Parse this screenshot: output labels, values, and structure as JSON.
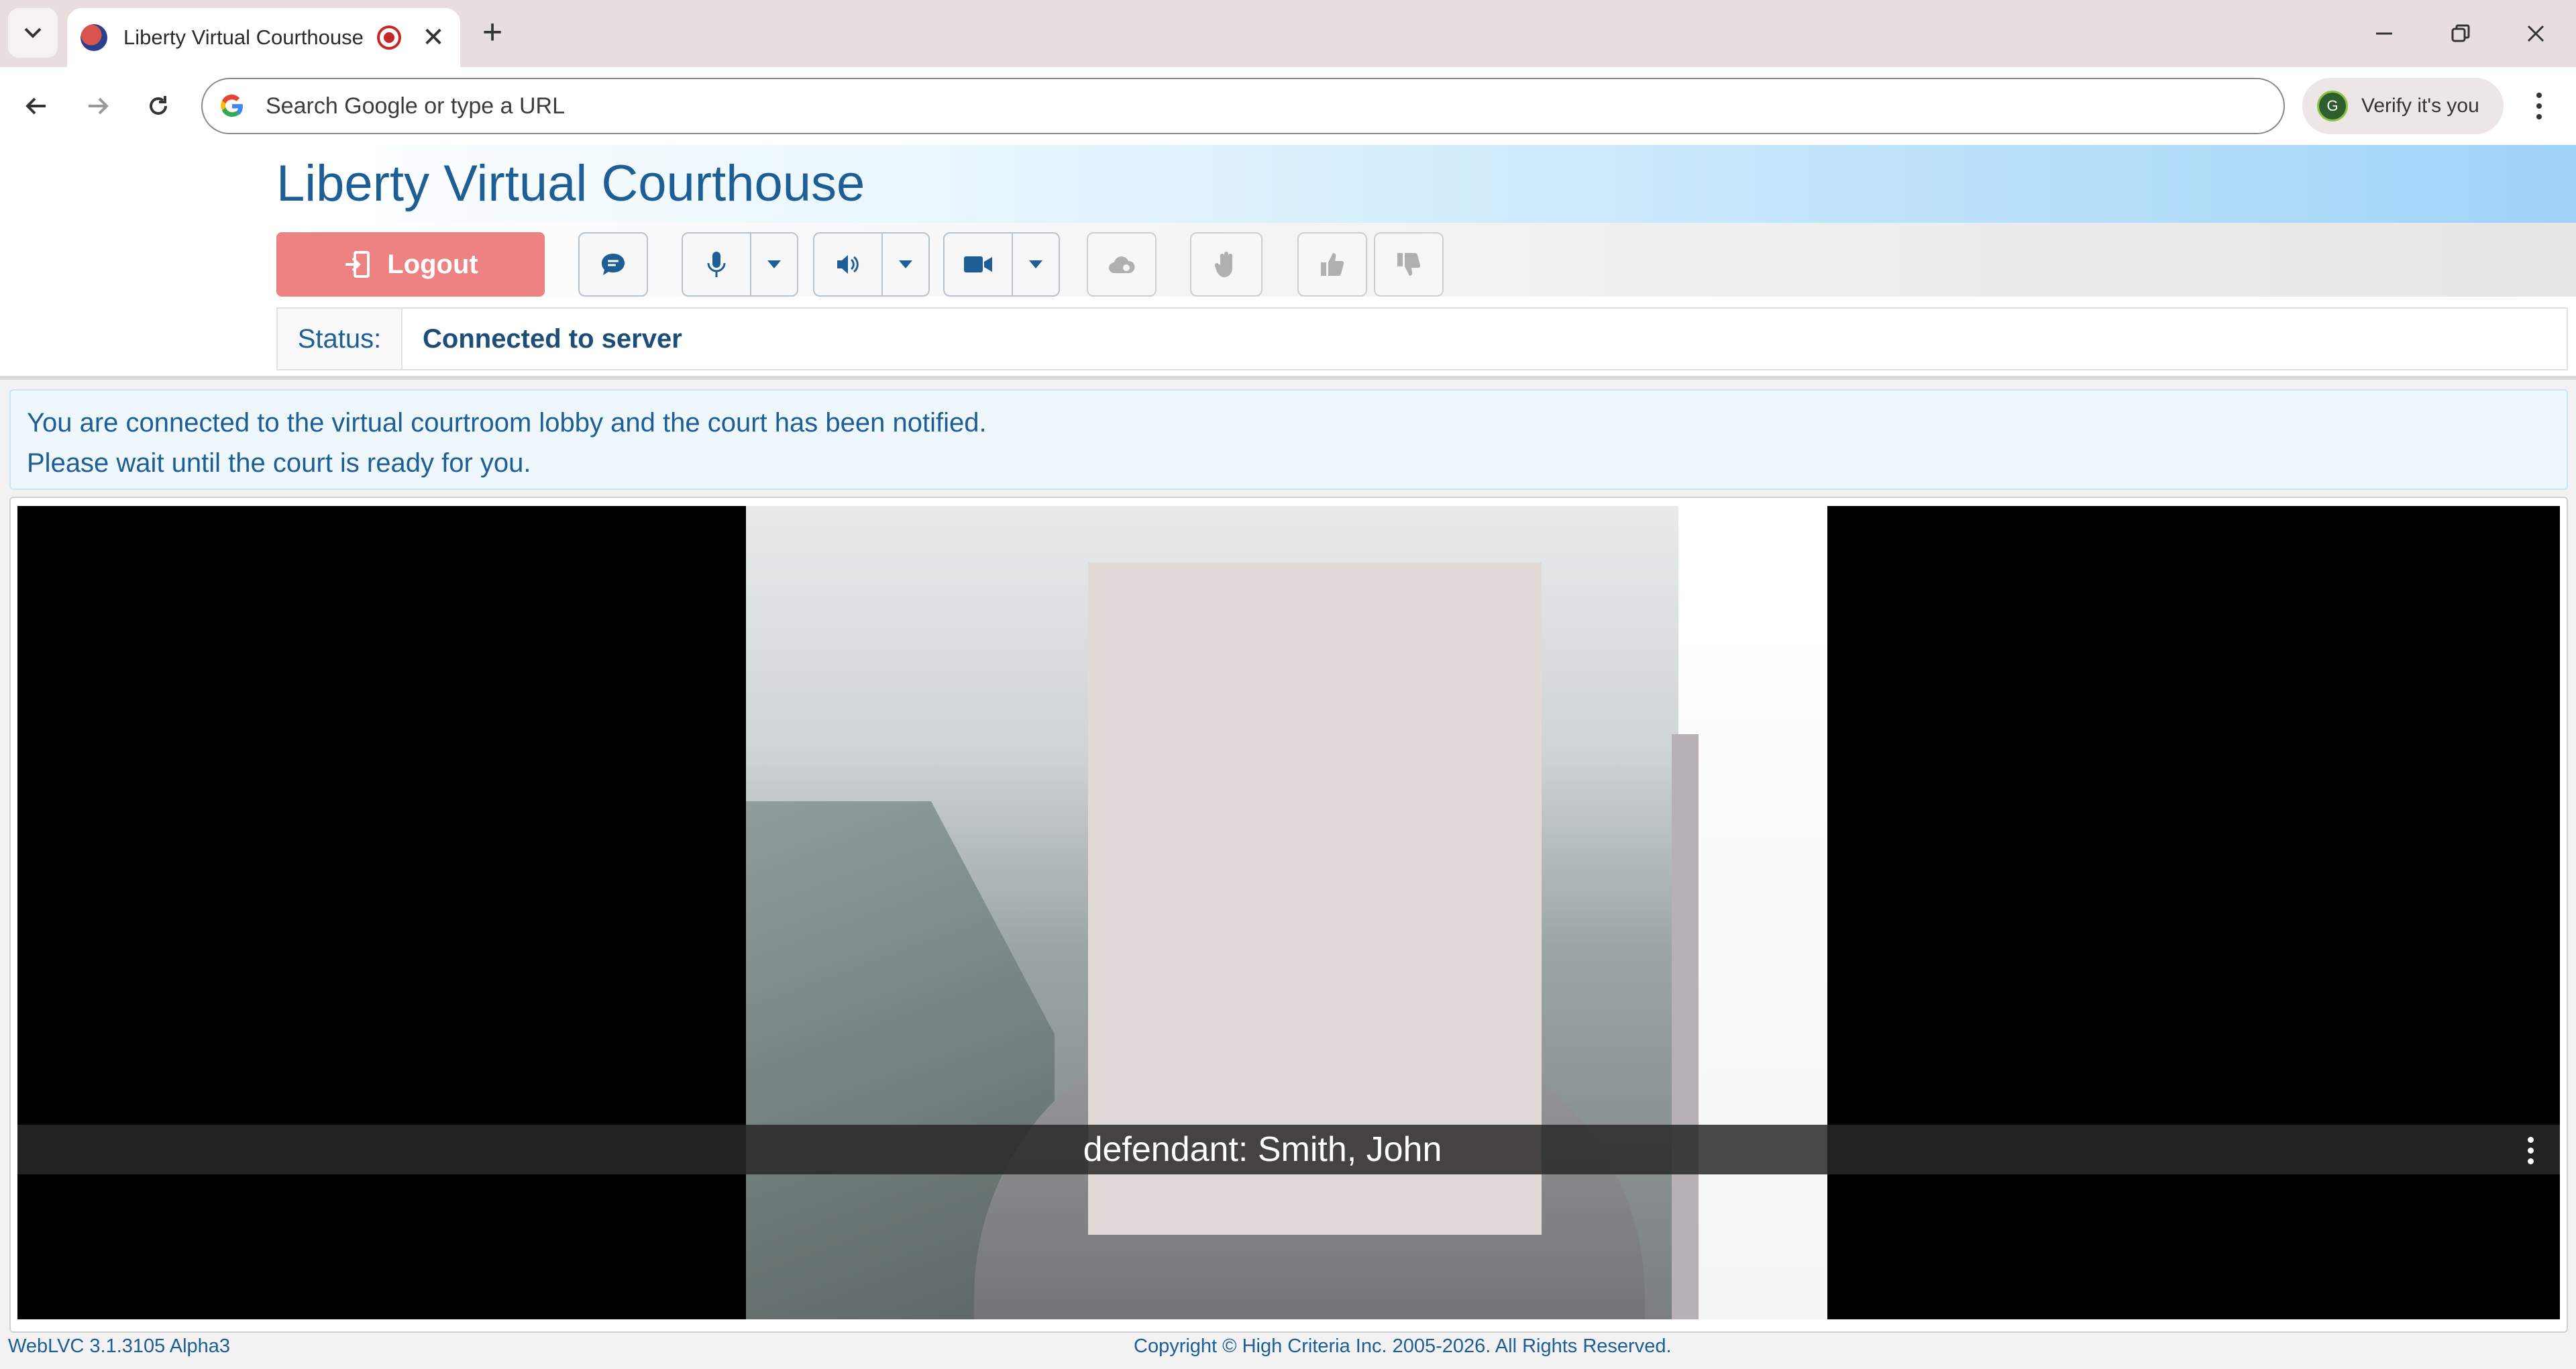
{
  "browser": {
    "tab_title": "Liberty Virtual Courthouse",
    "new_tab_icon": "+",
    "tab_close_icon": "✕",
    "address_placeholder": "Search Google or type a URL",
    "verify_label": "Verify it's you",
    "verify_avatar": "G"
  },
  "site": {
    "title": "Liberty Virtual Courthouse"
  },
  "controls": {
    "logout_label": "Logout"
  },
  "status": {
    "label": "Status:",
    "value": "Connected to server"
  },
  "notice": {
    "line1": "You are connected to the virtual courtroom lobby and the court has been notified.",
    "line2": "Please wait until the court is ready for you."
  },
  "video": {
    "caption": "defendant: Smith, John"
  },
  "footer": {
    "version": "WebLVC 3.1.3105 Alpha3",
    "copyright": "Copyright © High Criteria Inc. 2005-2026. All Rights Reserved."
  },
  "colors": {
    "brand": "#1d5e96",
    "logout": "#ee8181",
    "banner": "#9fd3f7"
  }
}
